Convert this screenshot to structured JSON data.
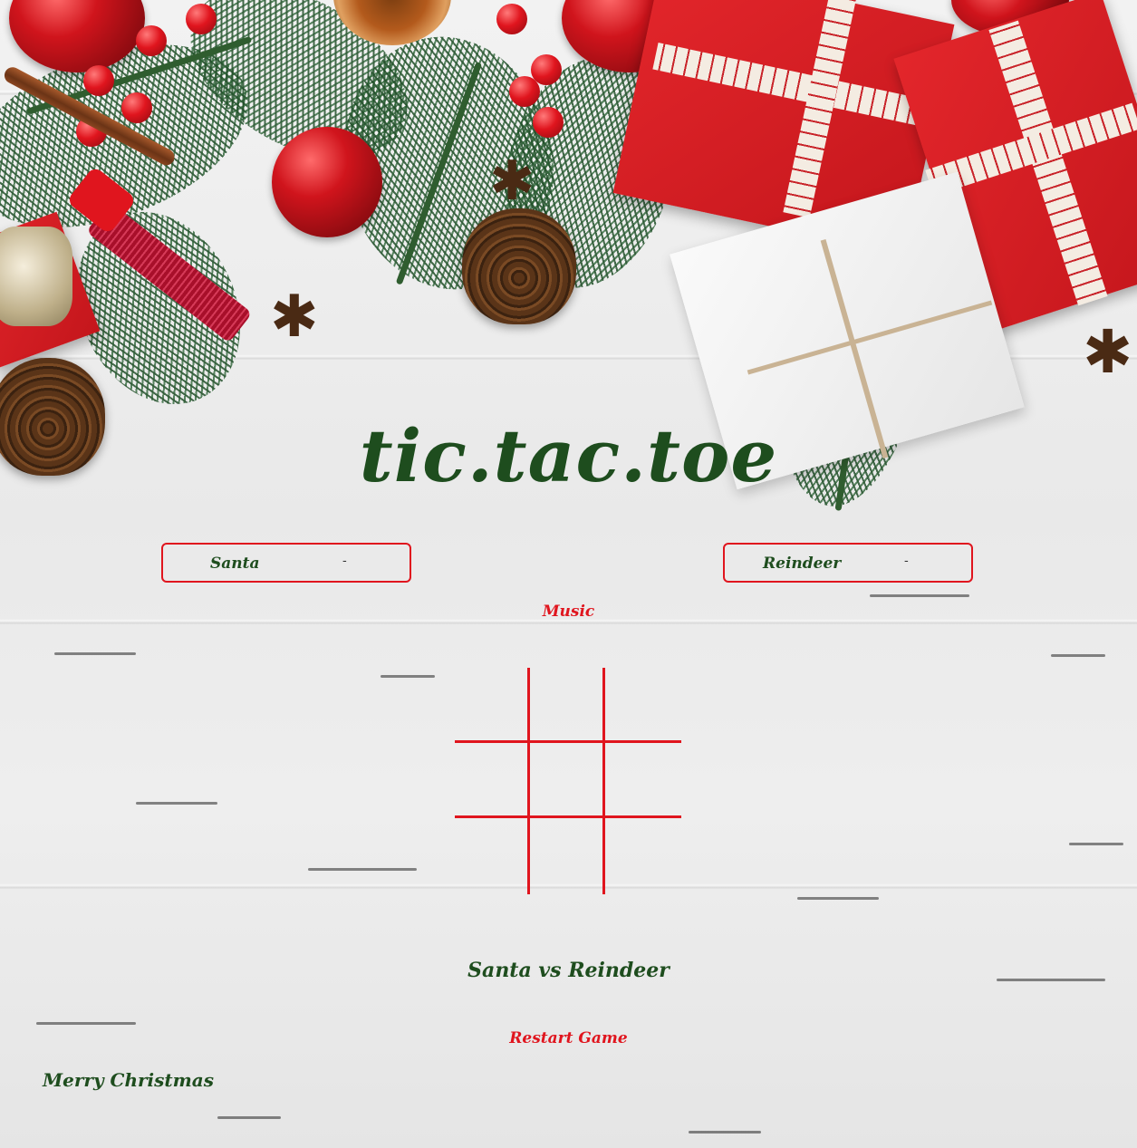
{
  "title": "tic.tac.toe",
  "players": {
    "left": {
      "name": "Santa",
      "score": "-"
    },
    "right": {
      "name": "Reindeer",
      "score": "-"
    }
  },
  "controls": {
    "music_label": "Music",
    "restart_label": "Restart Game"
  },
  "board": {
    "cells": [
      "",
      "",
      "",
      "",
      "",
      "",
      "",
      "",
      ""
    ]
  },
  "status": "Santa vs Reindeer",
  "footer": "Merry Christmas",
  "colors": {
    "accent_red": "#e0151e",
    "text_green": "#1e4d1e"
  }
}
